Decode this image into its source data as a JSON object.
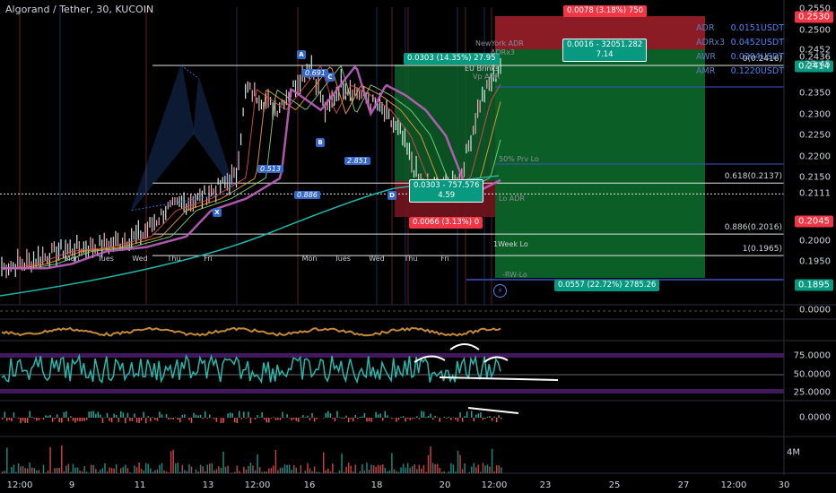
{
  "header": {
    "title": "Algorand / Tether, 30, KUCOIN"
  },
  "chart_data": {
    "type": "line",
    "title": "Algorand / Tether, 30, KUCOIN",
    "price_axis": {
      "ticks": [
        "0.2550",
        "0.2500",
        "0.2452",
        "0.2436",
        "0.2350",
        "0.2300",
        "0.2250",
        "0.2200",
        "0.2150",
        "0.2111",
        "0.2000",
        "0.1950",
        "0.1895"
      ],
      "tick_values": [
        0.255,
        0.25,
        0.2452,
        0.2436,
        0.235,
        0.23,
        0.225,
        0.22,
        0.215,
        0.2111,
        0.2,
        0.195,
        0.1895
      ],
      "ylim": [
        0.1895,
        0.255
      ]
    },
    "price_badges": [
      {
        "text": "0.2530",
        "value": 0.253,
        "color": "#f23645"
      },
      {
        "text": "0.2414",
        "value": 0.2414,
        "color": "#089981"
      },
      {
        "text": "0.2045",
        "value": 0.2045,
        "color": "#f23645"
      },
      {
        "text": "0.1895",
        "value": 0.1895,
        "color": "#089981"
      }
    ],
    "countdown": "23:45",
    "indicator_axis": {
      "panel1": "0.0000",
      "rsi": [
        "75.0000",
        "50.0000",
        "25.0000"
      ],
      "macd": "0.0000",
      "volume": "4M"
    },
    "time_axis": [
      "12:00",
      "9",
      "11",
      "13",
      "12:00",
      "16",
      "18",
      "20",
      "12:00",
      "23",
      "25",
      "27",
      "12:00",
      "30"
    ],
    "day_labels": [
      "Mon",
      "Tues",
      "Wed",
      "Thu",
      "Fri",
      "Mon",
      "Tues",
      "Wed",
      "Thu",
      "Fri"
    ],
    "stats": [
      {
        "k": "ADR",
        "v": "0.0151USDT"
      },
      {
        "k": "ADRx3",
        "v": "0.0452USDT"
      },
      {
        "k": "AWR",
        "v": "0.0204USDT"
      },
      {
        "k": "AMR",
        "v": "0.1220USDT"
      }
    ],
    "fib_levels": [
      {
        "label": "0(0.2416)",
        "value": 0.2416
      },
      {
        "label": "0.618(0.2137)",
        "value": 0.2137
      },
      {
        "label": "0.886(0.2016)",
        "value": 0.2016
      },
      {
        "label": "1(0.1965)",
        "value": 0.1965
      }
    ],
    "pattern_points": [
      {
        "label": "X",
        "t": 0.26,
        "v": 0.2072
      },
      {
        "label": "A",
        "t": 0.36,
        "v": 0.2416
      },
      {
        "label": "B",
        "t": 0.385,
        "v": 0.2255
      },
      {
        "label": "C",
        "t": 0.395,
        "v": 0.2385
      },
      {
        "label": "D",
        "t": 0.468,
        "v": 0.2116
      }
    ],
    "pattern_ratios": [
      "0.691",
      "0.513",
      "2.851",
      "0.886"
    ],
    "positions": [
      {
        "text": "0.0078 (3.18%) 750",
        "type": "loss"
      },
      {
        "text": "0.0303 (14.35%) 27.95",
        "type": "profit"
      },
      {
        "text": "0.0016 - 32051.282",
        "sub": "7.14",
        "type": "profit"
      },
      {
        "text": "0.0303 - 757.576",
        "sub": "4.59",
        "type": "profit"
      },
      {
        "text": "0.0066 (3.13%) 0",
        "type": "loss"
      },
      {
        "text": "0.0557 (22.72%) 2785.26",
        "type": "profit"
      }
    ],
    "level_labels": [
      "NewYork ADR",
      "ADRx3",
      "EU Brinks",
      "Vp ADR",
      "1Week Lo",
      "-RW-Lo",
      "50% Prv Lo",
      "Lo ADR"
    ],
    "series": [],
    "colors": {
      "up": "#089981",
      "down": "#f23645",
      "pattern": "#3568c9",
      "rsi": "#27b8b0"
    }
  }
}
